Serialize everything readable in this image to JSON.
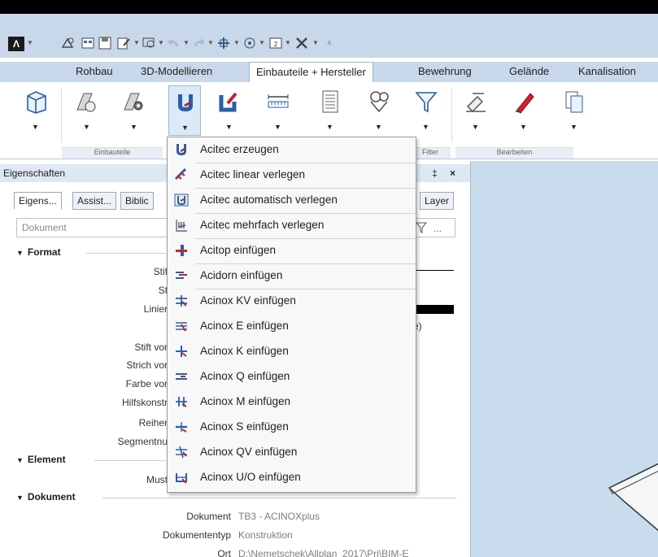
{
  "quick_access": {
    "logo_glyph": "Λ",
    "icons": [
      "project-icon",
      "layout-icon",
      "save-icon",
      "edit-icon",
      "zoom-icon",
      "undo-icon",
      "redo-icon",
      "move-icon",
      "view-icon",
      "window-icon",
      "tools-icon",
      "customize-icon"
    ]
  },
  "ribbon_tabs": [
    "Rohbau",
    "3D-Modellieren",
    "Einbauteile + Hersteller",
    "Bewehrung",
    "Gelände",
    "Kanalisation"
  ],
  "active_tab": "Einbauteile + Hersteller",
  "ribbon_groups": [
    "Einbauteile",
    "Filter",
    "Bearbeiten"
  ],
  "properties_panel": {
    "title": "Eigenschaften",
    "pin_glyph": "‡",
    "close_glyph": "×",
    "tabs": [
      "Eigens...",
      "Assist...",
      "Biblic",
      "Layer"
    ],
    "document_dropdown": "Dokument",
    "filter_more": "...",
    "sections": {
      "format": "Format",
      "element": "Element",
      "dokument": "Dokument"
    },
    "format_labels": [
      "Stif",
      "St",
      "Linier",
      "Stift vor",
      "Strich vor",
      "Farbe vor",
      "Hilfskonstr",
      "Reiher",
      "Segmentnu"
    ],
    "format_value_partial": "e)",
    "element_labels": [
      "Must"
    ],
    "document_props": [
      {
        "label": "Dokument",
        "value": "TB3 - ACINOXplus"
      },
      {
        "label": "Dokumententyp",
        "value": "Konstruktion"
      },
      {
        "label": "Ort",
        "value": "D:\\Nemetschek\\Allplan_2017\\Prj\\BIM-E"
      }
    ]
  },
  "dropdown_menu": {
    "items": [
      {
        "label": "Acitec erzeugen",
        "icon": "acitec-create-icon"
      },
      {
        "label": "Acitec linear verlegen",
        "icon": "acitec-linear-icon"
      },
      {
        "label": "Acitec automatisch verlegen",
        "icon": "acitec-auto-icon"
      },
      {
        "label": "Acitec mehrfach verlegen",
        "icon": "acitec-multi-icon"
      },
      {
        "label": "Acitop einfügen",
        "icon": "acitop-icon"
      },
      {
        "label": "Acidorn einfügen",
        "icon": "acidorn-icon"
      },
      {
        "label": "Acinox KV einfügen",
        "icon": "acinox-kv-icon"
      },
      {
        "label": "Acinox E einfügen",
        "icon": "acinox-e-icon"
      },
      {
        "label": "Acinox K einfügen",
        "icon": "acinox-k-icon"
      },
      {
        "label": "Acinox Q einfügen",
        "icon": "acinox-q-icon"
      },
      {
        "label": "Acinox M einfügen",
        "icon": "acinox-m-icon"
      },
      {
        "label": "Acinox S einfügen",
        "icon": "acinox-s-icon"
      },
      {
        "label": "Acinox QV einfügen",
        "icon": "acinox-qv-icon"
      },
      {
        "label": "Acinox U/O einfügen",
        "icon": "acinox-uo-icon"
      }
    ]
  },
  "colors": {
    "ribbon_bg": "#c8d8ea",
    "viewport_bg": "#c9dcee",
    "accent_blue": "#2a5ea8",
    "accent_red": "#c0242f"
  }
}
